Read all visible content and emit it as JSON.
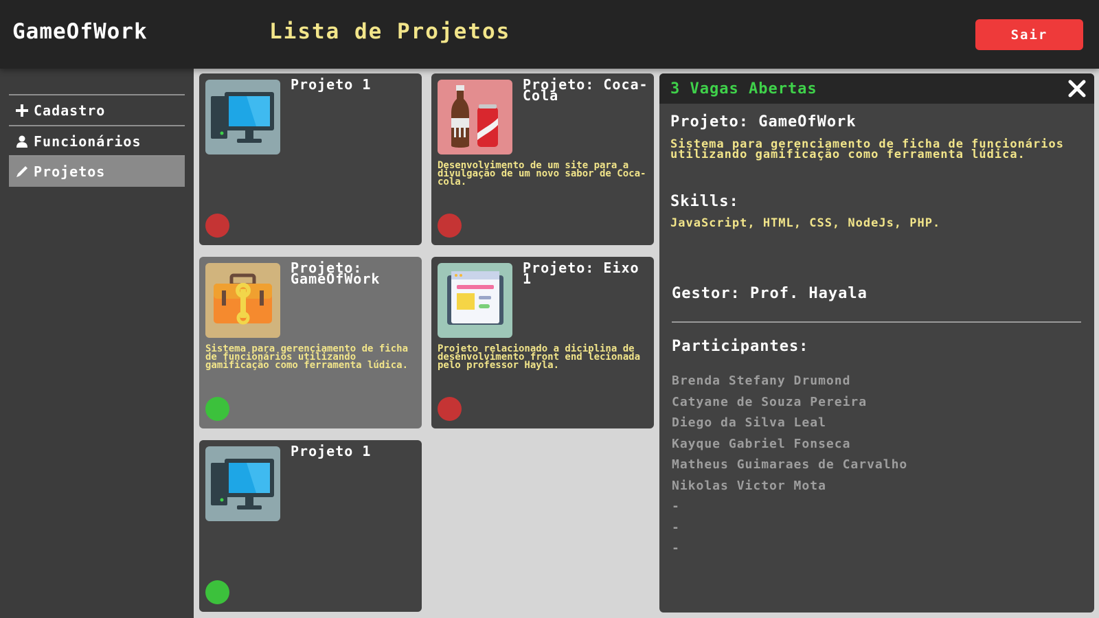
{
  "header": {
    "brand": "GameOfWork",
    "title": "Lista de Projetos",
    "logout_label": "Sair"
  },
  "sidebar": {
    "items": [
      {
        "label": "Cadastro",
        "icon": "plus-icon"
      },
      {
        "label": "Funcionários",
        "icon": "user-icon"
      },
      {
        "label": "Projetos",
        "icon": "pencil-icon",
        "active": true
      }
    ]
  },
  "projects": [
    {
      "title": "Projeto 1",
      "description": "",
      "image": "computer-icon",
      "status": "red"
    },
    {
      "title": "Projeto: Coca-Cola",
      "description": "Desenvolvimento de um site para a divulgação de um novo sabor de Coca-cola.",
      "image": "cola-icon",
      "status": "red"
    },
    {
      "title": "Projeto: GameOfWork",
      "description": "Sistema para gerenciamento de ficha de funcionários utilizando gamificação como ferramenta lúdica.",
      "image": "toolbox-icon",
      "status": "green",
      "selected": true
    },
    {
      "title": "Projeto: Eixo 1",
      "description": "Projeto relacionado a diciplina de desenvolvimento front end lecionada pelo professor Hayla.",
      "image": "webpage-icon",
      "status": "red"
    },
    {
      "title": "Projeto 1",
      "description": "",
      "image": "computer-icon",
      "status": "green"
    }
  ],
  "detail": {
    "vagas": "3 Vagas Abertas",
    "project_label": "Projeto: GameOfWork",
    "description": "Sistema para gerenciamento de ficha de funcionários utilizando gamificação como ferramenta lúdica.",
    "skills_label": "Skills:",
    "skills": "JavaScript, HTML, CSS, NodeJs, PHP.",
    "gestor": "Gestor: Prof. Hayala",
    "participants_label": "Participantes:",
    "participants": [
      "Brenda Stefany Drumond",
      "Catyane de Souza Pereira",
      "Diego da Silva Leal",
      "Kayque Gabriel Fonseca",
      "Matheus Guimaraes de Carvalho",
      "Nikolas Victor Mota",
      "-",
      "-",
      "-"
    ]
  },
  "colors": {
    "header_bg": "#242424",
    "accent_yellow": "#f2e58a",
    "logout_red": "#ee3a3a",
    "status_red": "#c53434",
    "status_green": "#3cc13c",
    "vagas_green": "#3fd14a"
  }
}
